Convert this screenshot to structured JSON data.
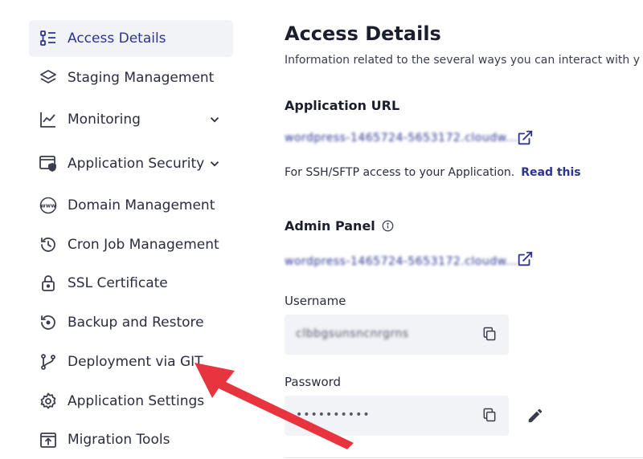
{
  "sidebar": {
    "items": [
      {
        "label": "Access Details",
        "icon": "access-details-icon",
        "active": true
      },
      {
        "label": "Staging Management",
        "icon": "layers-icon"
      },
      {
        "label": "Monitoring",
        "icon": "chart-line-icon",
        "expandable": true
      },
      {
        "label": "Application Security",
        "icon": "shield-window-icon",
        "expandable": true
      },
      {
        "label": "Domain Management",
        "icon": "www-globe-icon"
      },
      {
        "label": "Cron Job Management",
        "icon": "history-clock-icon"
      },
      {
        "label": "SSL Certificate",
        "icon": "lock-icon"
      },
      {
        "label": "Backup and Restore",
        "icon": "backup-icon"
      },
      {
        "label": "Deployment via GIT",
        "icon": "git-branch-icon"
      },
      {
        "label": "Application Settings",
        "icon": "gear-icon"
      },
      {
        "label": "Migration Tools",
        "icon": "migration-icon"
      }
    ]
  },
  "main": {
    "title": "Access Details",
    "description": "Information related to the several ways you can interact with y",
    "app_url": {
      "title": "Application URL",
      "value": "wordpress-1465724-5653172.cloudw...",
      "ssh_note": "For SSH/SFTP access to your Application.",
      "read_link": "Read this"
    },
    "admin_panel": {
      "title": "Admin Panel",
      "value": "wordpress-1465724-5653172.cloudw...",
      "username_label": "Username",
      "username_value": "clbbgsunsncnrgrns",
      "password_label": "Password",
      "password_value": "••••••••••"
    }
  },
  "colors": {
    "accent": "#2c3490",
    "annotation_arrow": "#e8343f",
    "active_bg": "#f2f3f6"
  }
}
